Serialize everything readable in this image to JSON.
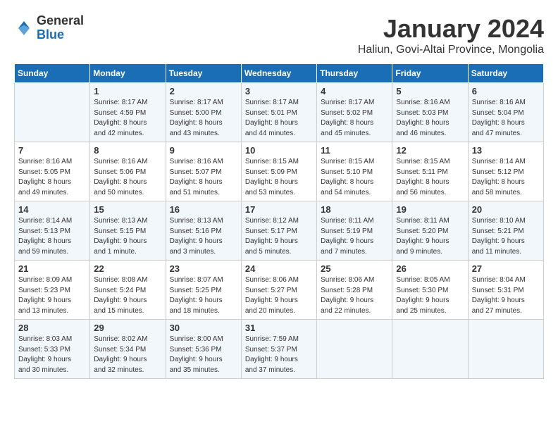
{
  "logo": {
    "general": "General",
    "blue": "Blue"
  },
  "title": "January 2024",
  "location": "Haliun, Govi-Altai Province, Mongolia",
  "weekdays": [
    "Sunday",
    "Monday",
    "Tuesday",
    "Wednesday",
    "Thursday",
    "Friday",
    "Saturday"
  ],
  "weeks": [
    [
      {
        "day": "",
        "info": ""
      },
      {
        "day": "1",
        "info": "Sunrise: 8:17 AM\nSunset: 4:59 PM\nDaylight: 8 hours\nand 42 minutes."
      },
      {
        "day": "2",
        "info": "Sunrise: 8:17 AM\nSunset: 5:00 PM\nDaylight: 8 hours\nand 43 minutes."
      },
      {
        "day": "3",
        "info": "Sunrise: 8:17 AM\nSunset: 5:01 PM\nDaylight: 8 hours\nand 44 minutes."
      },
      {
        "day": "4",
        "info": "Sunrise: 8:17 AM\nSunset: 5:02 PM\nDaylight: 8 hours\nand 45 minutes."
      },
      {
        "day": "5",
        "info": "Sunrise: 8:16 AM\nSunset: 5:03 PM\nDaylight: 8 hours\nand 46 minutes."
      },
      {
        "day": "6",
        "info": "Sunrise: 8:16 AM\nSunset: 5:04 PM\nDaylight: 8 hours\nand 47 minutes."
      }
    ],
    [
      {
        "day": "7",
        "info": "Sunrise: 8:16 AM\nSunset: 5:05 PM\nDaylight: 8 hours\nand 49 minutes."
      },
      {
        "day": "8",
        "info": "Sunrise: 8:16 AM\nSunset: 5:06 PM\nDaylight: 8 hours\nand 50 minutes."
      },
      {
        "day": "9",
        "info": "Sunrise: 8:16 AM\nSunset: 5:07 PM\nDaylight: 8 hours\nand 51 minutes."
      },
      {
        "day": "10",
        "info": "Sunrise: 8:15 AM\nSunset: 5:09 PM\nDaylight: 8 hours\nand 53 minutes."
      },
      {
        "day": "11",
        "info": "Sunrise: 8:15 AM\nSunset: 5:10 PM\nDaylight: 8 hours\nand 54 minutes."
      },
      {
        "day": "12",
        "info": "Sunrise: 8:15 AM\nSunset: 5:11 PM\nDaylight: 8 hours\nand 56 minutes."
      },
      {
        "day": "13",
        "info": "Sunrise: 8:14 AM\nSunset: 5:12 PM\nDaylight: 8 hours\nand 58 minutes."
      }
    ],
    [
      {
        "day": "14",
        "info": "Sunrise: 8:14 AM\nSunset: 5:13 PM\nDaylight: 8 hours\nand 59 minutes."
      },
      {
        "day": "15",
        "info": "Sunrise: 8:13 AM\nSunset: 5:15 PM\nDaylight: 9 hours\nand 1 minute."
      },
      {
        "day": "16",
        "info": "Sunrise: 8:13 AM\nSunset: 5:16 PM\nDaylight: 9 hours\nand 3 minutes."
      },
      {
        "day": "17",
        "info": "Sunrise: 8:12 AM\nSunset: 5:17 PM\nDaylight: 9 hours\nand 5 minutes."
      },
      {
        "day": "18",
        "info": "Sunrise: 8:11 AM\nSunset: 5:19 PM\nDaylight: 9 hours\nand 7 minutes."
      },
      {
        "day": "19",
        "info": "Sunrise: 8:11 AM\nSunset: 5:20 PM\nDaylight: 9 hours\nand 9 minutes."
      },
      {
        "day": "20",
        "info": "Sunrise: 8:10 AM\nSunset: 5:21 PM\nDaylight: 9 hours\nand 11 minutes."
      }
    ],
    [
      {
        "day": "21",
        "info": "Sunrise: 8:09 AM\nSunset: 5:23 PM\nDaylight: 9 hours\nand 13 minutes."
      },
      {
        "day": "22",
        "info": "Sunrise: 8:08 AM\nSunset: 5:24 PM\nDaylight: 9 hours\nand 15 minutes."
      },
      {
        "day": "23",
        "info": "Sunrise: 8:07 AM\nSunset: 5:25 PM\nDaylight: 9 hours\nand 18 minutes."
      },
      {
        "day": "24",
        "info": "Sunrise: 8:06 AM\nSunset: 5:27 PM\nDaylight: 9 hours\nand 20 minutes."
      },
      {
        "day": "25",
        "info": "Sunrise: 8:06 AM\nSunset: 5:28 PM\nDaylight: 9 hours\nand 22 minutes."
      },
      {
        "day": "26",
        "info": "Sunrise: 8:05 AM\nSunset: 5:30 PM\nDaylight: 9 hours\nand 25 minutes."
      },
      {
        "day": "27",
        "info": "Sunrise: 8:04 AM\nSunset: 5:31 PM\nDaylight: 9 hours\nand 27 minutes."
      }
    ],
    [
      {
        "day": "28",
        "info": "Sunrise: 8:03 AM\nSunset: 5:33 PM\nDaylight: 9 hours\nand 30 minutes."
      },
      {
        "day": "29",
        "info": "Sunrise: 8:02 AM\nSunset: 5:34 PM\nDaylight: 9 hours\nand 32 minutes."
      },
      {
        "day": "30",
        "info": "Sunrise: 8:00 AM\nSunset: 5:36 PM\nDaylight: 9 hours\nand 35 minutes."
      },
      {
        "day": "31",
        "info": "Sunrise: 7:59 AM\nSunset: 5:37 PM\nDaylight: 9 hours\nand 37 minutes."
      },
      {
        "day": "",
        "info": ""
      },
      {
        "day": "",
        "info": ""
      },
      {
        "day": "",
        "info": ""
      }
    ]
  ]
}
